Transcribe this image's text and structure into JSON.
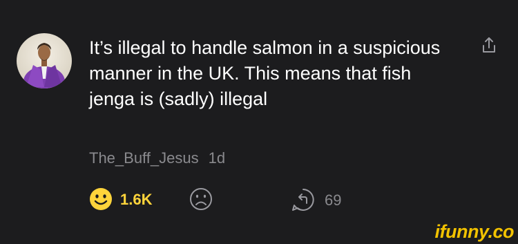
{
  "comment": {
    "text": "It’s illegal to handle salmon in a suspicious manner in the UK. This means that fish jenga is (sadly) illegal",
    "username": "The_Buff_Jesus",
    "time": "1d",
    "smile_count": "1.6K",
    "reply_count": "69"
  },
  "watermark": "ifunny.co",
  "colors": {
    "background": "#1c1c1e",
    "text": "#ffffff",
    "muted": "#8a8a8e",
    "smile": "#ffd43b",
    "watermark": "#f2c200"
  },
  "icons": {
    "share": "share-icon",
    "smile": "smile-icon",
    "frown": "frown-icon",
    "reply": "reply-icon"
  }
}
